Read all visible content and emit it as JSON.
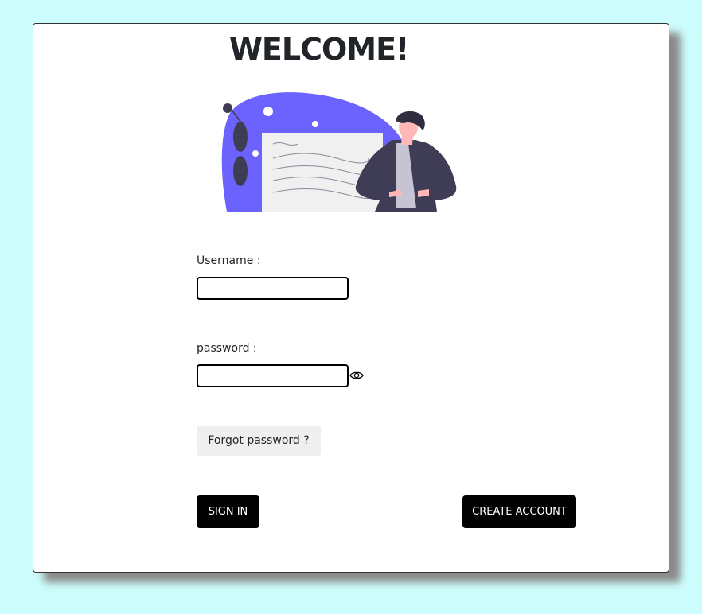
{
  "page": {
    "title": "WELCOME!",
    "colors": {
      "background": "#ccfcfb",
      "card": "#ffffff",
      "illustration_accent": "#6c63ff",
      "button_dark": "#000000",
      "forgot_bg": "#efefef"
    }
  },
  "illustration": {
    "icon": "person-presenting-board-illustration"
  },
  "form": {
    "username": {
      "label": "Username :",
      "value": "",
      "placeholder": ""
    },
    "password": {
      "label": "password :",
      "value": "",
      "placeholder": "",
      "toggle_icon": "eye-icon"
    },
    "forgot_label": "Forgot password ?",
    "signin_label": "SIGN IN",
    "create_label": "CREATE ACCOUNT"
  }
}
